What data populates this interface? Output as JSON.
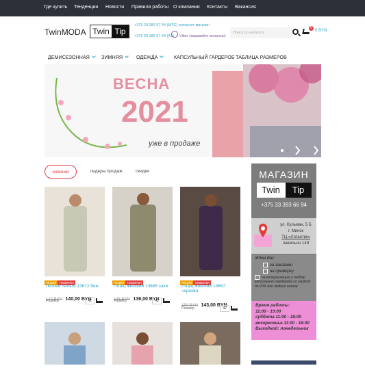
{
  "topnav": [
    "Где купить",
    "Тенденции",
    "Новости",
    "Правила работы",
    "О компании",
    "Контакты",
    "Вакансия"
  ],
  "logo": {
    "twin": "Twin",
    "moda": "MODA",
    "twin2": "Twin",
    "tip": "Tip"
  },
  "phones": [
    "+375 29 280 97 94 (МТС) интернет-магазин",
    "+375 29 183 97 94 (A1)",
    "Viber (задавайте вопросы)"
  ],
  "search": {
    "placeholder": "Поиск по каталогу"
  },
  "cart": {
    "count": "0",
    "total": "0 BYN"
  },
  "nav": [
    "ДЕМИСЕЗОННАЯ",
    "ЗИМНЯЯ",
    "ОДЕЖДА",
    "КАПСУЛЬНЫЙ ГАРДЕРОБ",
    "ТАБЛИЦА РАЗМЕРОВ"
  ],
  "banner": {
    "line1": "ВЕСНА",
    "line2": "2021",
    "line3": "уже в продаже"
  },
  "tabs": [
    "новинки",
    "лидеры продаж",
    "скидки"
  ],
  "products": [
    {
      "name": "Летнее пальто 13672 беж",
      "old": "147 BYN",
      "new": "140,00 BYN",
      "size_label": "Размер",
      "size": "42",
      "sale": "АКЦИЯ",
      "new_badge": "НОВИНКА"
    },
    {
      "name": "Плащ женский 13665 хаки",
      "old": "145 BYN",
      "new": "136,00 BYN",
      "size_label": "Размер",
      "size": "42",
      "sale": "АКЦИЯ",
      "new_badge": "НОВИНКА"
    },
    {
      "name": "Плащ женский 13667 черника",
      "old": "150 BYN",
      "new": "143,00 BYN",
      "size_label": "Размер",
      "size": "42",
      "sale": "АКЦИЯ",
      "new_badge": "НОВИНКА"
    }
  ],
  "sidebar": {
    "title": "МАГАЗИН",
    "logo_twin": "Twin",
    "logo_tip": "Tip",
    "phone": "+375 33 393 66 94",
    "address": [
      "ул. Кульман, 5 Б",
      "г. Минск",
      "ТЦ «Атлантик»",
      "павильон 149"
    ],
    "wait_title": "Ждем Вас:",
    "wait": [
      "за заказами",
      "на примерку",
      "на консультацию и подбор капсульного гардероба со скидкой до 20% для любого сезона"
    ],
    "hours": [
      "Время работы:",
      "11:00 - 19:00",
      "суббота 11:00 - 18:00",
      "воскресенье 11:00 - 16:00",
      "Выходной: понедельник"
    ]
  }
}
